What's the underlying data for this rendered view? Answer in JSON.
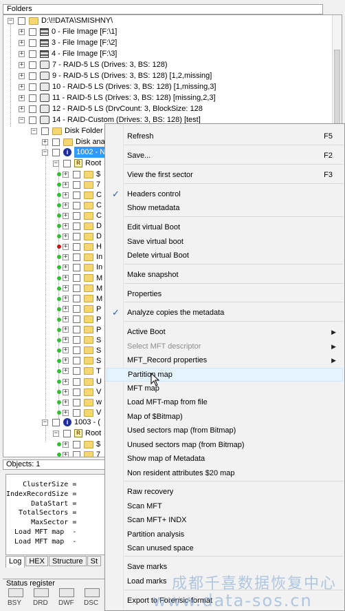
{
  "folders_header": "Folders",
  "tree": {
    "root": "D:\\!!DATA\\SMISHNY\\",
    "items": [
      "0 - File Image [F:\\1]",
      "3 - File Image [F:\\2]",
      "4 - File Image [F:\\3]",
      "7 - RAID-5 LS (Drives: 3, BS: 128)",
      "9 - RAID-5 LS (Drives: 3, BS: 128) [1,2,missing]",
      "10 - RAID-5 LS (Drives: 3, BS: 128) [1,missing,3]",
      "11 - RAID-5 LS (Drives: 3, BS: 128) [missing,2,3]",
      "12 - RAID-5 LS (DrvCount: 3, BlockSize: 128",
      "14 - RAID-Custom (Drives: 3, BS: 128) [test]"
    ],
    "disk_folder": "Disk Folder R",
    "disk_ana": "Disk ana",
    "selected_node": "1002 - N",
    "root_label": "Root",
    "folder_letters": [
      "$",
      "7",
      "C",
      "C",
      "C",
      "D",
      "D",
      "H",
      "In",
      "In",
      "M",
      "M",
      "M",
      "P",
      "P",
      "P",
      "S",
      "S",
      "S",
      "T",
      "U",
      "V",
      "w",
      "V"
    ],
    "node_1003": "1003 - (",
    "root_label_2": "Root",
    "folder_letters_2": [
      "$",
      "7"
    ]
  },
  "objects_header": "Objects: 1",
  "log_lines": [
    "    ClusterSize = ",
    "IndexRecordSize = ",
    "      DataStart = ",
    "   TotalSectors = ",
    "      MaxSector = ",
    "  Load MFT map  - ",
    "  Load MFT map  - "
  ],
  "tabs": [
    "Log",
    "HEX",
    "Structure",
    "St"
  ],
  "status_register": {
    "title": "Status register",
    "flags": [
      "BSY",
      "DRD",
      "DWF",
      "DSC"
    ]
  },
  "context_menu": {
    "items": [
      {
        "label": "Refresh",
        "shortcut": "F5"
      },
      {
        "label": "Save...",
        "shortcut": "F2"
      },
      {
        "label": "View the first sector",
        "shortcut": "F3"
      },
      {
        "label": "Headers control",
        "checked": "true"
      },
      {
        "label": "Show metadata"
      },
      {
        "label": "Edit virtual Boot"
      },
      {
        "label": "Save virtual boot"
      },
      {
        "label": "Delete virtual Boot"
      },
      {
        "label": "Make snapshot"
      },
      {
        "label": "Properties"
      },
      {
        "label": "Analyze copies the metadata",
        "checked": "true"
      },
      {
        "label": "Active Boot",
        "submenu": "true"
      },
      {
        "label": "Select MFT descriptor",
        "submenu": "true",
        "disabled": "true"
      },
      {
        "label": "MFT_Record properties",
        "submenu": "true"
      },
      {
        "label": "Partition map",
        "hover": "true"
      },
      {
        "label": "MFT map"
      },
      {
        "label": "Load MFT-map from file"
      },
      {
        "label": "Map of $Bitmap)"
      },
      {
        "label": "Used sectors map (from Bitmap)"
      },
      {
        "label": "Unused sectors map (from Bitmap)"
      },
      {
        "label": "Show map of Metadata"
      },
      {
        "label": "Non resident attributes $20 map"
      },
      {
        "label": "Raw recovery"
      },
      {
        "label": "Scan MFT"
      },
      {
        "label": "Scan MFT+ INDX"
      },
      {
        "label": "Partition analysis"
      },
      {
        "label": "Scan unused space"
      },
      {
        "label": "Save marks"
      },
      {
        "label": "Load marks"
      },
      {
        "label": "Export to Forensic-format"
      }
    ]
  },
  "watermark": {
    "cn": "成都千喜数据恢复中心",
    "url": "www.data-sos.cn"
  },
  "colors": {
    "selection": "#3399ff",
    "menu_bg": "#f2f2f2",
    "hover": "#e5f3ff",
    "check": "#1a5fb4"
  }
}
